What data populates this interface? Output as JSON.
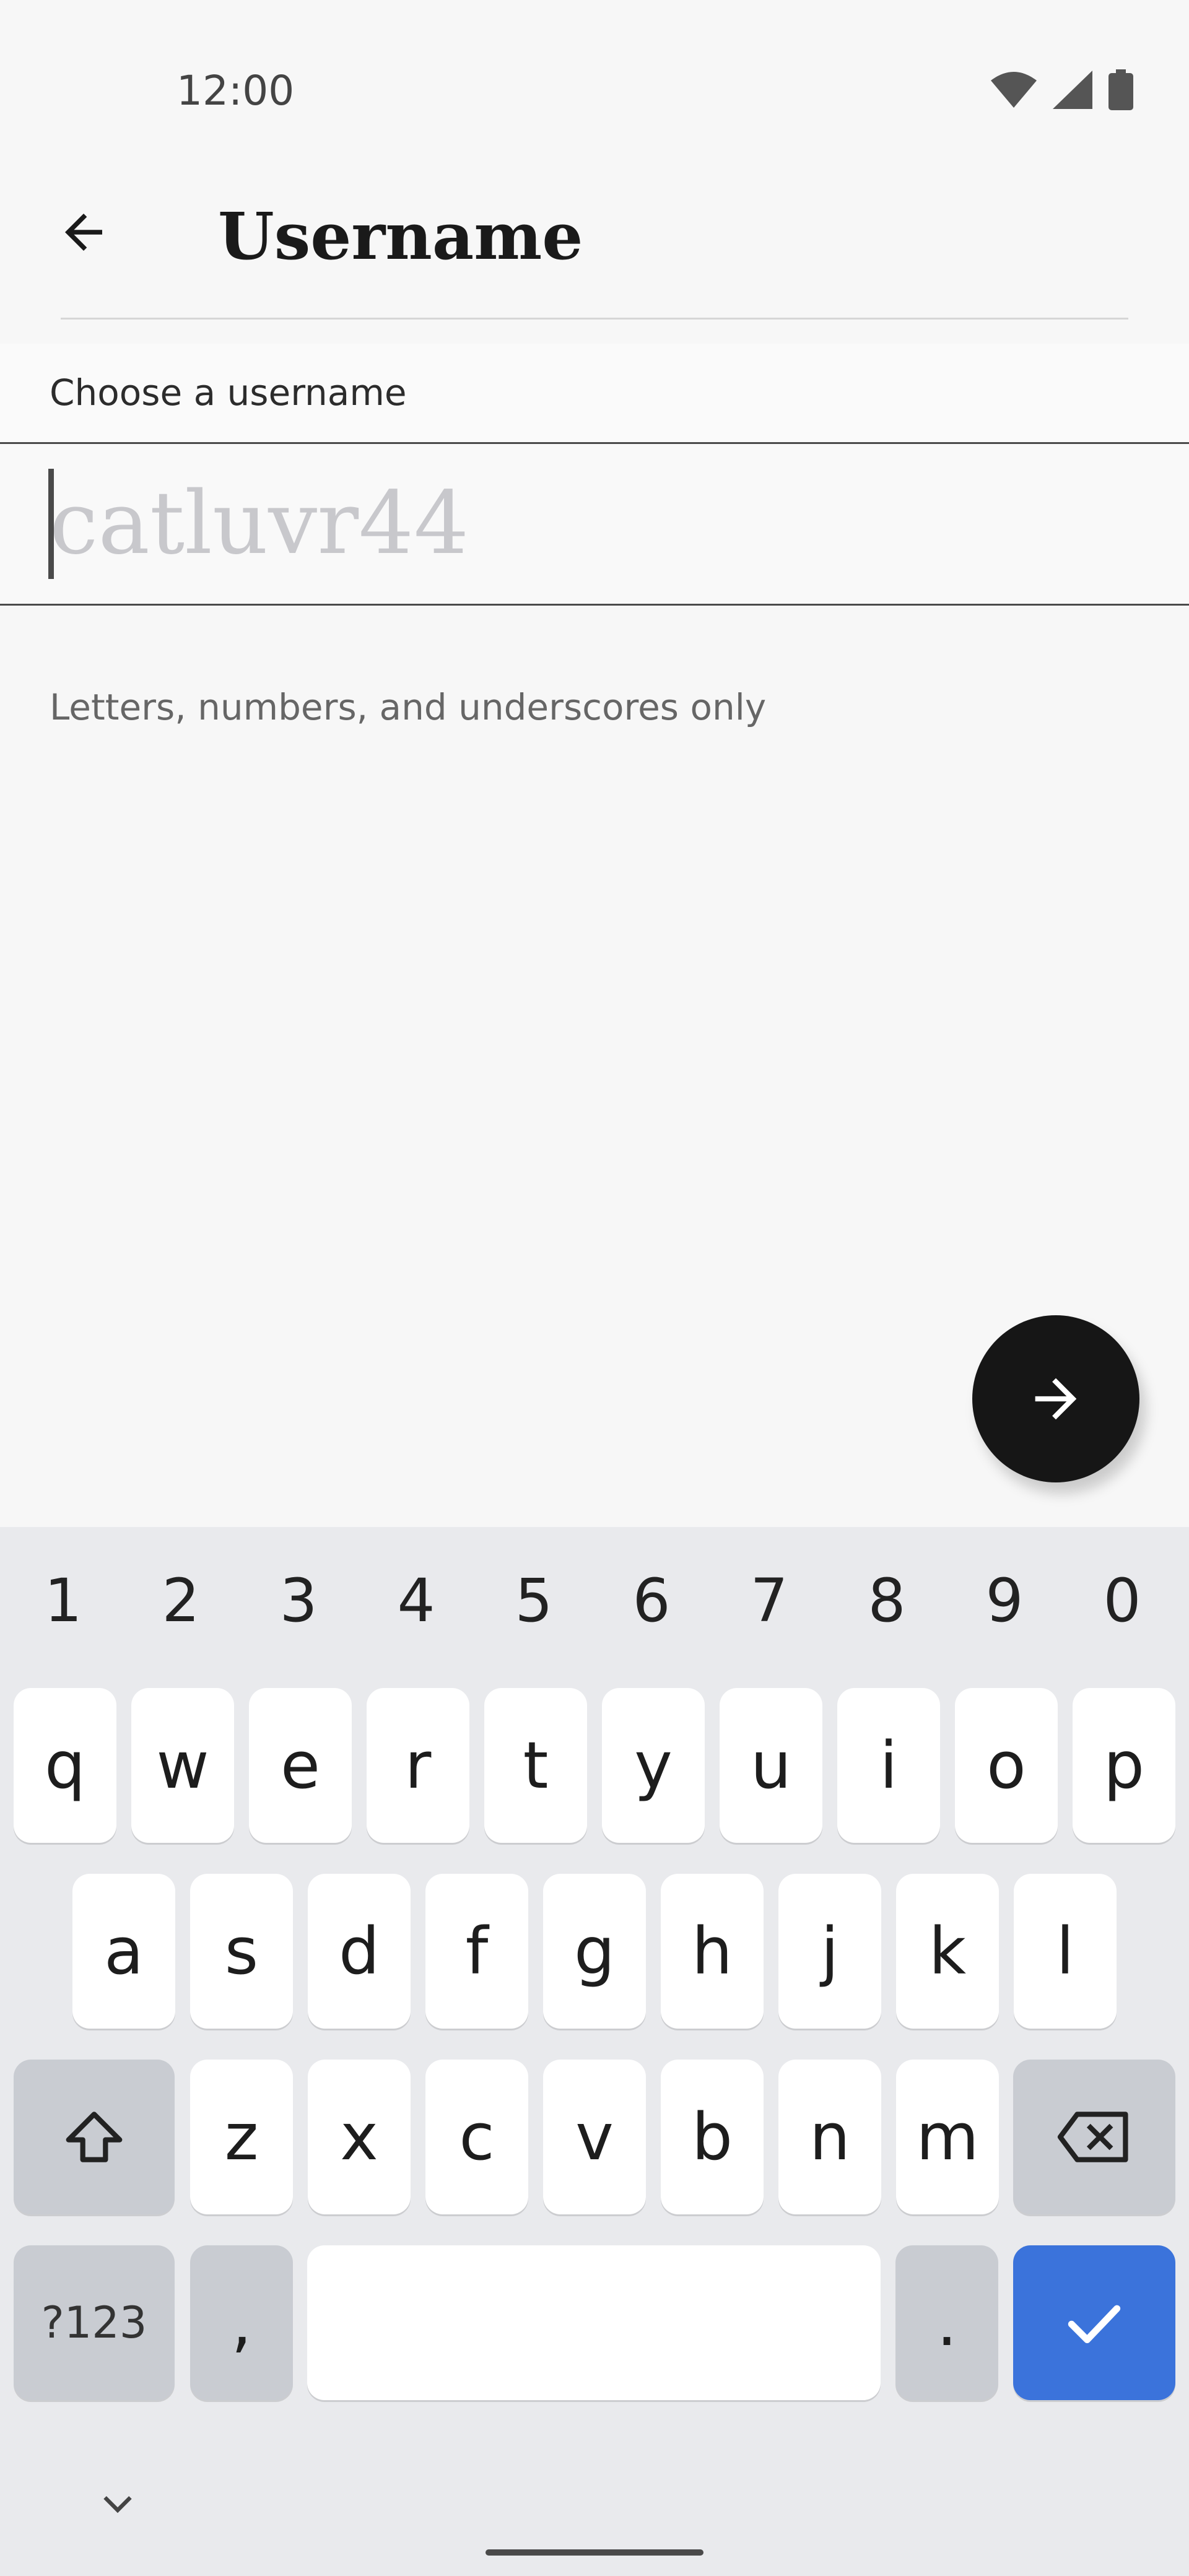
{
  "status_bar": {
    "time": "12:00",
    "icons": [
      "wifi-icon",
      "signal-icon",
      "battery-icon"
    ]
  },
  "header": {
    "title": "Username",
    "back_icon": "arrow-left-icon"
  },
  "form": {
    "label": "Choose a username",
    "value": "",
    "placeholder": "catluvr44",
    "helper": "Letters, numbers, and underscores only"
  },
  "fab": {
    "icon": "arrow-right-icon"
  },
  "keyboard": {
    "numbers": [
      "1",
      "2",
      "3",
      "4",
      "5",
      "6",
      "7",
      "8",
      "9",
      "0"
    ],
    "row1": [
      "q",
      "w",
      "e",
      "r",
      "t",
      "y",
      "u",
      "i",
      "o",
      "p"
    ],
    "row2": [
      "a",
      "s",
      "d",
      "f",
      "g",
      "h",
      "j",
      "k",
      "l"
    ],
    "row3": [
      "z",
      "x",
      "c",
      "v",
      "b",
      "n",
      "m"
    ],
    "symbols_label": "?123",
    "comma_label": ",",
    "period_label": ".",
    "accent_color": "#3b73db"
  },
  "colors": {
    "background": "#f7f7f7",
    "fab": "#161616",
    "keyboard_bg": "#e9eaed"
  }
}
